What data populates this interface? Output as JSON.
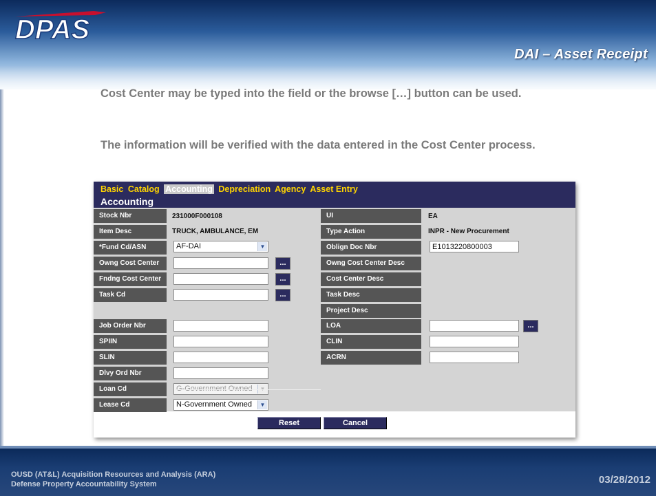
{
  "slide": {
    "logo_text": "DPAS",
    "title": "DAI – Asset Receipt",
    "paragraph1": "Cost Center may be typed into the field or the browse […] button can be used.",
    "paragraph2": "The information will be verified with the data entered in the Cost Center process.",
    "footer_line1": "OUSD (AT&L) Acquisition Resources and Analysis (ARA)",
    "footer_line2": "Defense Property Accountability System",
    "date": "03/28/2012"
  },
  "app": {
    "tabs": [
      {
        "label": "Basic"
      },
      {
        "label": "Catalog"
      },
      {
        "label": "Accounting"
      },
      {
        "label": "Depreciation"
      },
      {
        "label": "Agency"
      },
      {
        "label": "Asset Entry"
      }
    ],
    "section_title": "Accounting",
    "fields": {
      "stock_nbr": {
        "label": "Stock Nbr",
        "value": "231000F000108"
      },
      "item_desc": {
        "label": "Item Desc",
        "value": "TRUCK, AMBULANCE, EM"
      },
      "fund_cd": {
        "label": "*Fund Cd/ASN",
        "value": "AF-DAI"
      },
      "owng_cost_center": {
        "label": "Owng Cost Center",
        "value": ""
      },
      "fndng_cost_center": {
        "label": "Fndng Cost Center",
        "value": ""
      },
      "task_cd": {
        "label": "Task Cd",
        "value": ""
      },
      "job_order_nbr": {
        "label": "Job Order Nbr",
        "value": ""
      },
      "spiin": {
        "label": "SPIIN",
        "value": ""
      },
      "slin": {
        "label": "SLIN",
        "value": ""
      },
      "dlvy_ord_nbr": {
        "label": "Dlvy Ord Nbr",
        "value": ""
      },
      "loan_cd": {
        "label": "Loan Cd",
        "value": "G-Government Owned"
      },
      "lease_cd": {
        "label": "Lease Cd",
        "value": "N-Government Owned"
      },
      "ui": {
        "label": "UI",
        "value": "EA"
      },
      "type_action": {
        "label": "Type Action",
        "value": "INPR - New Procurement"
      },
      "oblign_doc_nbr": {
        "label": "Oblign Doc Nbr",
        "value": "E1013220800003"
      },
      "owng_cost_center_desc": {
        "label": "Owng Cost Center Desc",
        "value": ""
      },
      "cost_center_desc": {
        "label": "Cost Center Desc",
        "value": ""
      },
      "task_desc": {
        "label": "Task Desc",
        "value": ""
      },
      "project_desc": {
        "label": "Project Desc",
        "value": ""
      },
      "loa": {
        "label": "LOA",
        "value": ""
      },
      "clin": {
        "label": "CLIN",
        "value": ""
      },
      "acrn": {
        "label": "ACRN",
        "value": ""
      }
    },
    "browse_label": "...",
    "reset_label": "Reset",
    "cancel_label": "Cancel"
  },
  "colors": {
    "header_navy": "#2b2b5e",
    "tab_yellow": "#ffd400",
    "label_gray": "#555555",
    "form_bg": "#d4d4d4"
  }
}
